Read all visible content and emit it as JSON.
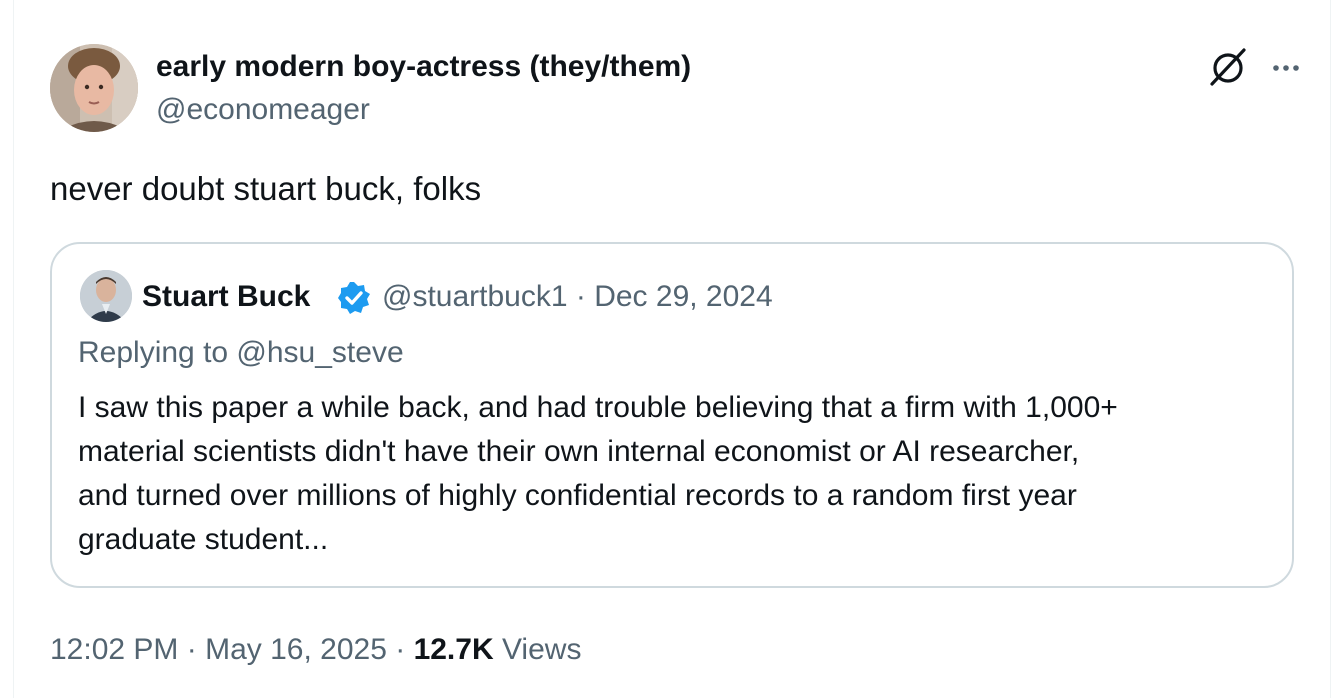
{
  "tweet": {
    "author_name": "early modern boy-actress (they/them)",
    "author_handle": "@economeager",
    "text": "never doubt stuart buck, folks",
    "time": "12:02 PM",
    "separator": " · ",
    "date": "May 16, 2025",
    "views_count": "12.7K",
    "views_label": "Views"
  },
  "quoted": {
    "author_name": "Stuart Buck",
    "handle_and_date": "@stuartbuck1 · Dec 29, 2024",
    "replying_to": "Replying to @hsu_steve",
    "body_lines": [
      "I saw this paper a while back, and had trouble believing that a firm with 1,000+",
      "material scientists didn't have their own internal economist or AI researcher,",
      "and turned over millions of highly confidential records to a random first year",
      "graduate student..."
    ]
  },
  "icons": {
    "grok": "grok-icon",
    "more": "more-icon",
    "verified": "verified-badge-icon"
  },
  "colors": {
    "text_primary": "#0f1419",
    "text_secondary": "#536471",
    "border": "#cfd9de",
    "verified": "#1d9bf0"
  }
}
